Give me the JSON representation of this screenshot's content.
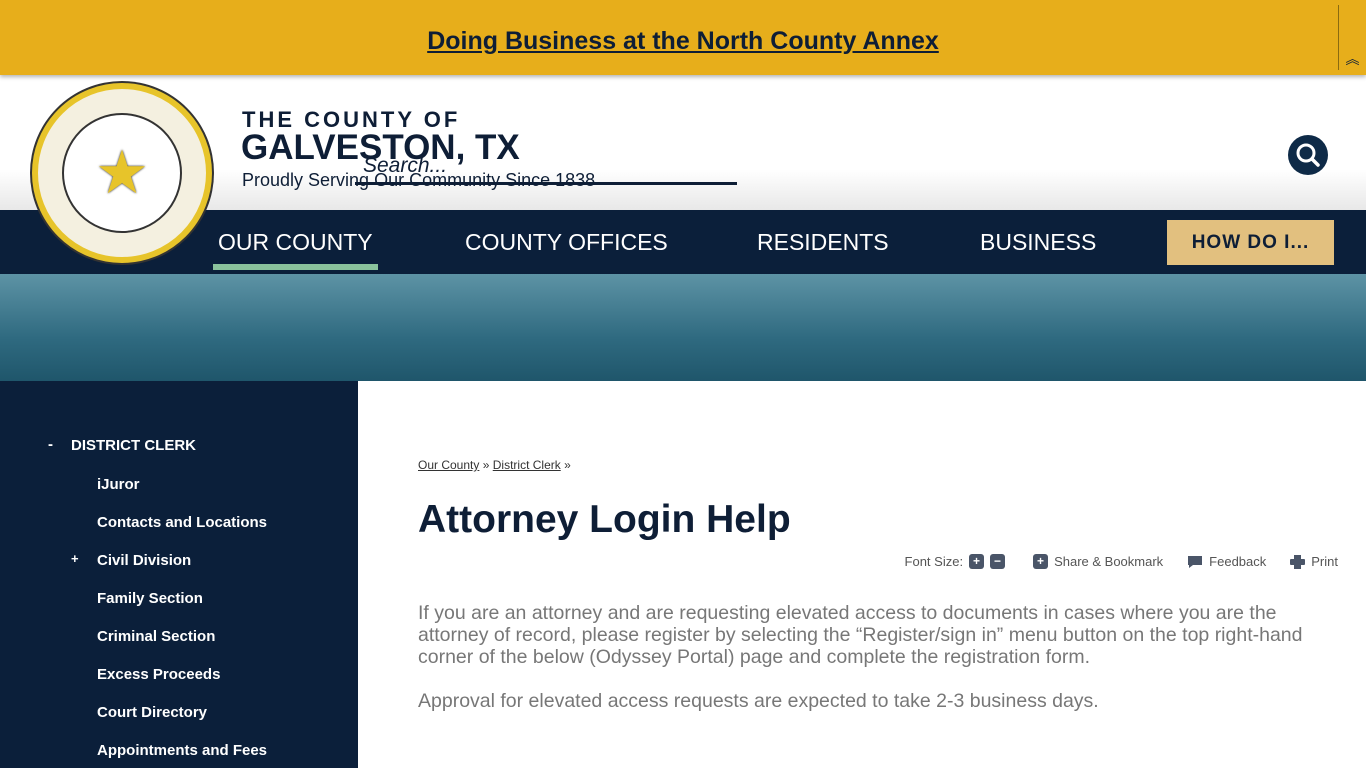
{
  "alert": {
    "text": "Doing Business at the North County Annex",
    "collapse_icon": "double-chevron-up"
  },
  "header": {
    "line1": "THE COUNTY OF",
    "line2": "GALVESTON, TX",
    "tagline": "Proudly Serving Our Community Since 1838",
    "search_placeholder": "Search...",
    "seal_star": "★"
  },
  "nav": {
    "items": [
      "OUR COUNTY",
      "COUNTY OFFICES",
      "RESIDENTS",
      "BUSINESS"
    ],
    "cta": "HOW DO I..."
  },
  "sidebar": {
    "parent": "DISTRICT CLERK",
    "parent_toggle": "-",
    "items": [
      {
        "label": "iJuror"
      },
      {
        "label": "Contacts and Locations"
      },
      {
        "label": "Civil Division",
        "toggle": "+"
      },
      {
        "label": "Family Section"
      },
      {
        "label": "Criminal Section"
      },
      {
        "label": "Excess Proceeds"
      },
      {
        "label": "Court Directory"
      },
      {
        "label": "Appointments and Fees"
      }
    ]
  },
  "breadcrumb": [
    "Our County",
    "District Clerk"
  ],
  "breadcrumb_sep": "»",
  "page_title": "Attorney Login Help",
  "tools": {
    "font_size": "Font Size:",
    "plus": "+",
    "minus": "−",
    "share": "Share & Bookmark",
    "feedback": "Feedback",
    "print": "Print"
  },
  "content": [
    "If you are an attorney and are requesting elevated access to documents in cases where you are the attorney of record, please register by selecting the “Register/sign in” menu button on the top right-hand corner of the below (Odyssey Portal) page and complete the registration form.",
    "Approval for elevated access requests are expected to take 2-3 business days."
  ]
}
